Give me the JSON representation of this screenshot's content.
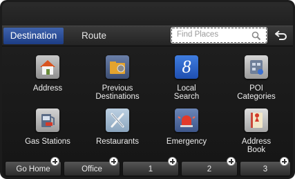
{
  "tabs": {
    "destination_label": "Destination",
    "route_label": "Route"
  },
  "search": {
    "placeholder": "Find Places",
    "icon": "search-icon"
  },
  "back_icon": "back-arrow-icon",
  "menu": [
    {
      "label_line1": "Address",
      "label_line2": "",
      "icon": "house-icon"
    },
    {
      "label_line1": "Previous",
      "label_line2": "Destinations",
      "icon": "folder-flag-icon"
    },
    {
      "label_line1": "Local",
      "label_line2": "Search",
      "icon": "google-icon",
      "icon_text": "8"
    },
    {
      "label_line1": "POI",
      "label_line2": "Categories",
      "icon": "poi-categories-icon"
    },
    {
      "label_line1": "Gas Stations",
      "label_line2": "",
      "icon": "gas-pump-icon"
    },
    {
      "label_line1": "Restaurants",
      "label_line2": "",
      "icon": "fork-knife-icon"
    },
    {
      "label_line1": "Emergency",
      "label_line2": "",
      "icon": "emergency-siren-icon"
    },
    {
      "label_line1": "Address",
      "label_line2": "Book",
      "icon": "address-book-icon"
    }
  ],
  "presets": [
    {
      "label": "Go Home"
    },
    {
      "label": "Office"
    },
    {
      "label": "1"
    },
    {
      "label": "2"
    },
    {
      "label": "3"
    }
  ],
  "colors": {
    "active_tab": "#2a4c97",
    "background": "#151515"
  }
}
